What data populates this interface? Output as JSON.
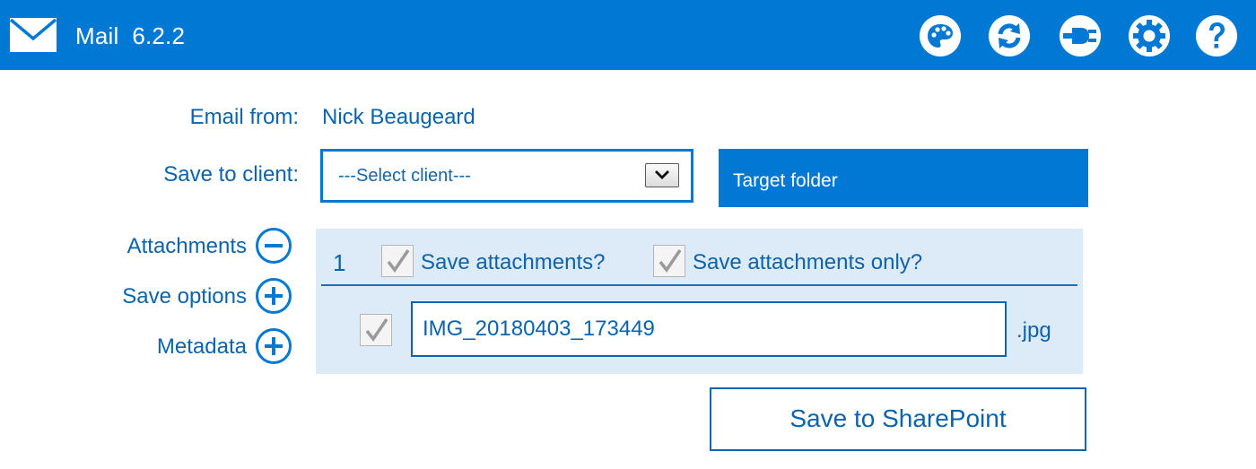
{
  "header": {
    "app_name": "Mail",
    "version": "6.2.2",
    "title": "Mail  6.2.2",
    "logo_icon": "envelope-icon",
    "icons": [
      "palette-icon",
      "refresh-icon",
      "plugin-icon",
      "settings-icon",
      "help-icon"
    ]
  },
  "form": {
    "email_from_label": "Email from:",
    "email_from_value": "Nick Beaugeard",
    "save_to_client_label": "Save to client:",
    "client_select_value": "---Select client---",
    "target_folder_label": "Target folder"
  },
  "sections": {
    "attachments_label": "Attachments",
    "attachments_state": "expanded",
    "save_options_label": "Save options",
    "save_options_state": "collapsed",
    "metadata_label": "Metadata",
    "metadata_state": "collapsed"
  },
  "attachments": {
    "count": "1",
    "save_attachments_label": "Save attachments?",
    "save_attachments_checked": true,
    "save_attachments_only_label": "Save attachments only?",
    "save_attachments_only_checked": true,
    "items": [
      {
        "checked": true,
        "name": "IMG_20180403_173449",
        "extension": ".jpg"
      }
    ]
  },
  "actions": {
    "save_label": "Save to SharePoint"
  },
  "colors": {
    "accent": "#0078d4",
    "text": "#0b63ad",
    "panel": "#ddeaf8"
  }
}
